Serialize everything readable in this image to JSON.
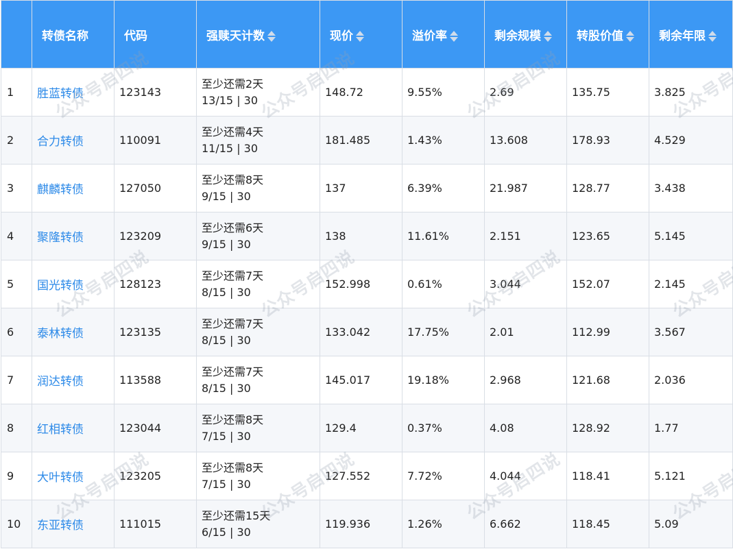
{
  "table": {
    "headers": [
      {
        "label": "",
        "sortable": false
      },
      {
        "label": "转债名称",
        "sortable": false
      },
      {
        "label": "代码",
        "sortable": false
      },
      {
        "label": "强赎天计数",
        "sortable": true
      },
      {
        "label": "现价",
        "sortable": true
      },
      {
        "label": "溢价率",
        "sortable": true
      },
      {
        "label": "剩余规模",
        "sortable": true
      },
      {
        "label": "转股价值",
        "sortable": true
      },
      {
        "label": "剩余年限",
        "sortable": true
      }
    ],
    "rows": [
      {
        "idx": "1",
        "name": "胜蓝转债",
        "code": "123143",
        "countdown_line1": "至少还需2天",
        "countdown_line2": "13/15 | 30",
        "price": "148.72",
        "premium": "9.55%",
        "remaining_size": "2.69",
        "conversion_value": "135.75",
        "remaining_years": "3.825"
      },
      {
        "idx": "2",
        "name": "合力转债",
        "code": "110091",
        "countdown_line1": "至少还需4天",
        "countdown_line2": "11/15 | 30",
        "price": "181.485",
        "premium": "1.43%",
        "remaining_size": "13.608",
        "conversion_value": "178.93",
        "remaining_years": "4.529"
      },
      {
        "idx": "3",
        "name": "麒麟转债",
        "code": "127050",
        "countdown_line1": "至少还需8天",
        "countdown_line2": "9/15 | 30",
        "price": "137",
        "premium": "6.39%",
        "remaining_size": "21.987",
        "conversion_value": "128.77",
        "remaining_years": "3.438"
      },
      {
        "idx": "4",
        "name": "聚隆转债",
        "code": "123209",
        "countdown_line1": "至少还需6天",
        "countdown_line2": "9/15 | 30",
        "price": "138",
        "premium": "11.61%",
        "remaining_size": "2.151",
        "conversion_value": "123.65",
        "remaining_years": "5.145"
      },
      {
        "idx": "5",
        "name": "国光转债",
        "code": "128123",
        "countdown_line1": "至少还需7天",
        "countdown_line2": "8/15 | 30",
        "price": "152.998",
        "premium": "0.61%",
        "remaining_size": "3.044",
        "conversion_value": "152.07",
        "remaining_years": "2.145"
      },
      {
        "idx": "6",
        "name": "泰林转债",
        "code": "123135",
        "countdown_line1": "至少还需7天",
        "countdown_line2": "8/15 | 30",
        "price": "133.042",
        "premium": "17.75%",
        "remaining_size": "2.01",
        "conversion_value": "112.99",
        "remaining_years": "3.567"
      },
      {
        "idx": "7",
        "name": "润达转债",
        "code": "113588",
        "countdown_line1": "至少还需7天",
        "countdown_line2": "8/15 | 30",
        "price": "145.017",
        "premium": "19.18%",
        "remaining_size": "2.968",
        "conversion_value": "121.68",
        "remaining_years": "2.036"
      },
      {
        "idx": "8",
        "name": "红相转债",
        "code": "123044",
        "countdown_line1": "至少还需8天",
        "countdown_line2": "7/15 | 30",
        "price": "129.4",
        "premium": "0.37%",
        "remaining_size": "4.08",
        "conversion_value": "128.92",
        "remaining_years": "1.77"
      },
      {
        "idx": "9",
        "name": "大叶转债",
        "code": "123205",
        "countdown_line1": "至少还需8天",
        "countdown_line2": "7/15 | 30",
        "price": "127.552",
        "premium": "7.72%",
        "remaining_size": "4.044",
        "conversion_value": "118.41",
        "remaining_years": "5.121"
      },
      {
        "idx": "10",
        "name": "东亚转债",
        "code": "111015",
        "countdown_line1": "至少还需15天",
        "countdown_line2": "6/15 | 30",
        "price": "119.936",
        "premium": "1.26%",
        "remaining_size": "6.662",
        "conversion_value": "118.45",
        "remaining_years": "5.09"
      }
    ]
  },
  "watermark": {
    "text": "公众号启四说"
  },
  "colors": {
    "header_bg": "#3c98f4",
    "header_text": "#ffffff",
    "link": "#2d8ae8",
    "row_alt": "#f5f7fa",
    "border": "#d9dee5"
  },
  "icons": {
    "sort": "sort-caret-icon"
  }
}
